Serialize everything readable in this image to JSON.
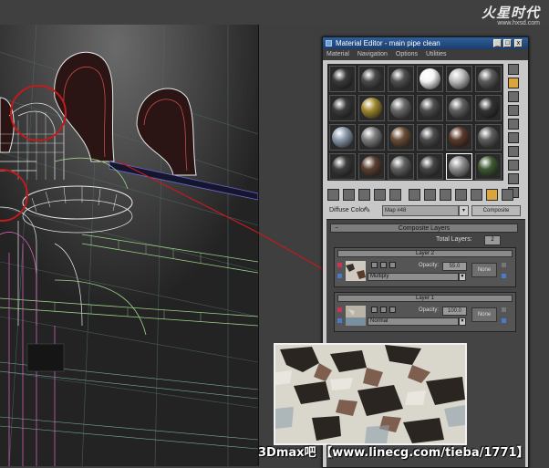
{
  "logo": {
    "main": "火星时代",
    "sub": "www.hxsd.com"
  },
  "material_editor": {
    "title": "Material Editor - main pipe clean",
    "menu": [
      "Material",
      "Navigation",
      "Options",
      "Utilities"
    ],
    "window_buttons": [
      "_",
      "□",
      "x"
    ],
    "slot_materials": [
      {
        "name": "dark-glossy",
        "color": "#3a3a3a"
      },
      {
        "name": "dark-metal",
        "color": "#4a4a4a"
      },
      {
        "name": "dark-metal",
        "color": "#505050"
      },
      {
        "name": "white",
        "color": "#f5f5f5"
      },
      {
        "name": "silver",
        "color": "#bdbdbd"
      },
      {
        "name": "gray",
        "color": "#5b5b5b"
      },
      {
        "name": "dark-rough",
        "color": "#3c3c3c"
      },
      {
        "name": "gold",
        "color": "#a0882e"
      },
      {
        "name": "gray-rough",
        "color": "#6a6a6a"
      },
      {
        "name": "dark-gray",
        "color": "#4e4e4e"
      },
      {
        "name": "gray",
        "color": "#606060"
      },
      {
        "name": "dark",
        "color": "#333333"
      },
      {
        "name": "steel-blue",
        "color": "#8a9aac"
      },
      {
        "name": "concrete",
        "color": "#7e7e7e"
      },
      {
        "name": "brown-rust",
        "color": "#6a4e36"
      },
      {
        "name": "dark-gray",
        "color": "#4c4c4c"
      },
      {
        "name": "rust",
        "color": "#5a3a2a"
      },
      {
        "name": "gray",
        "color": "#5e5e5e"
      },
      {
        "name": "dark-rough",
        "color": "#3e3e3e"
      },
      {
        "name": "brown",
        "color": "#5a4030"
      },
      {
        "name": "gray-rough",
        "color": "#626262"
      },
      {
        "name": "dark-glossy",
        "color": "#454545"
      },
      {
        "name": "peeling-paint",
        "color": "#8f8f8f"
      },
      {
        "name": "mossy-green",
        "color": "#3f5a32"
      }
    ],
    "active_slot": 22,
    "diffuse_label": "Diffuse Color",
    "map_name": "Map #48",
    "map_type": "Composite",
    "composite_title": "Composite Layers",
    "total_layers_label": "Total Layers:",
    "total_layers": "2",
    "layers": [
      {
        "title": "Layer 2",
        "opacity_label": "Opacity:",
        "opacity": "55.0",
        "blend": "Multiply",
        "mask": "None"
      },
      {
        "title": "Layer 1",
        "opacity_label": "Opacity:",
        "opacity": "100.0",
        "blend": "Normal",
        "mask": "None"
      }
    ],
    "side_tool_icons": [
      "sphere-icon",
      "sample-type-icon",
      "backlight-icon",
      "checker-background-icon",
      "uv-tiling-icon",
      "video-check-icon",
      "make-preview-icon",
      "options-icon",
      "select-by-material-icon",
      "material-navigator-icon"
    ],
    "bottom_tool_icons": [
      "get-material-icon",
      "put-to-scene-icon",
      "assign-to-selection-icon",
      "reset-map-icon",
      "copy-material-icon",
      "make-unique-icon",
      "put-to-library-icon",
      "material-effects-channel-icon",
      "show-map-icon",
      "show-end-result-icon",
      "go-to-parent-icon",
      "go-forward-icon"
    ]
  },
  "viewport": {
    "label": "3D viewport wireframe pipes"
  },
  "watermark": "3Dmax吧 【www.linecg.com/tieba/1771】",
  "colors": {
    "wire_white": "#e8e8e8",
    "wire_pink": "#d15fb8",
    "wire_green": "#9ed48a",
    "wire_red": "#c41a1a",
    "accent": "#d9a53d"
  }
}
